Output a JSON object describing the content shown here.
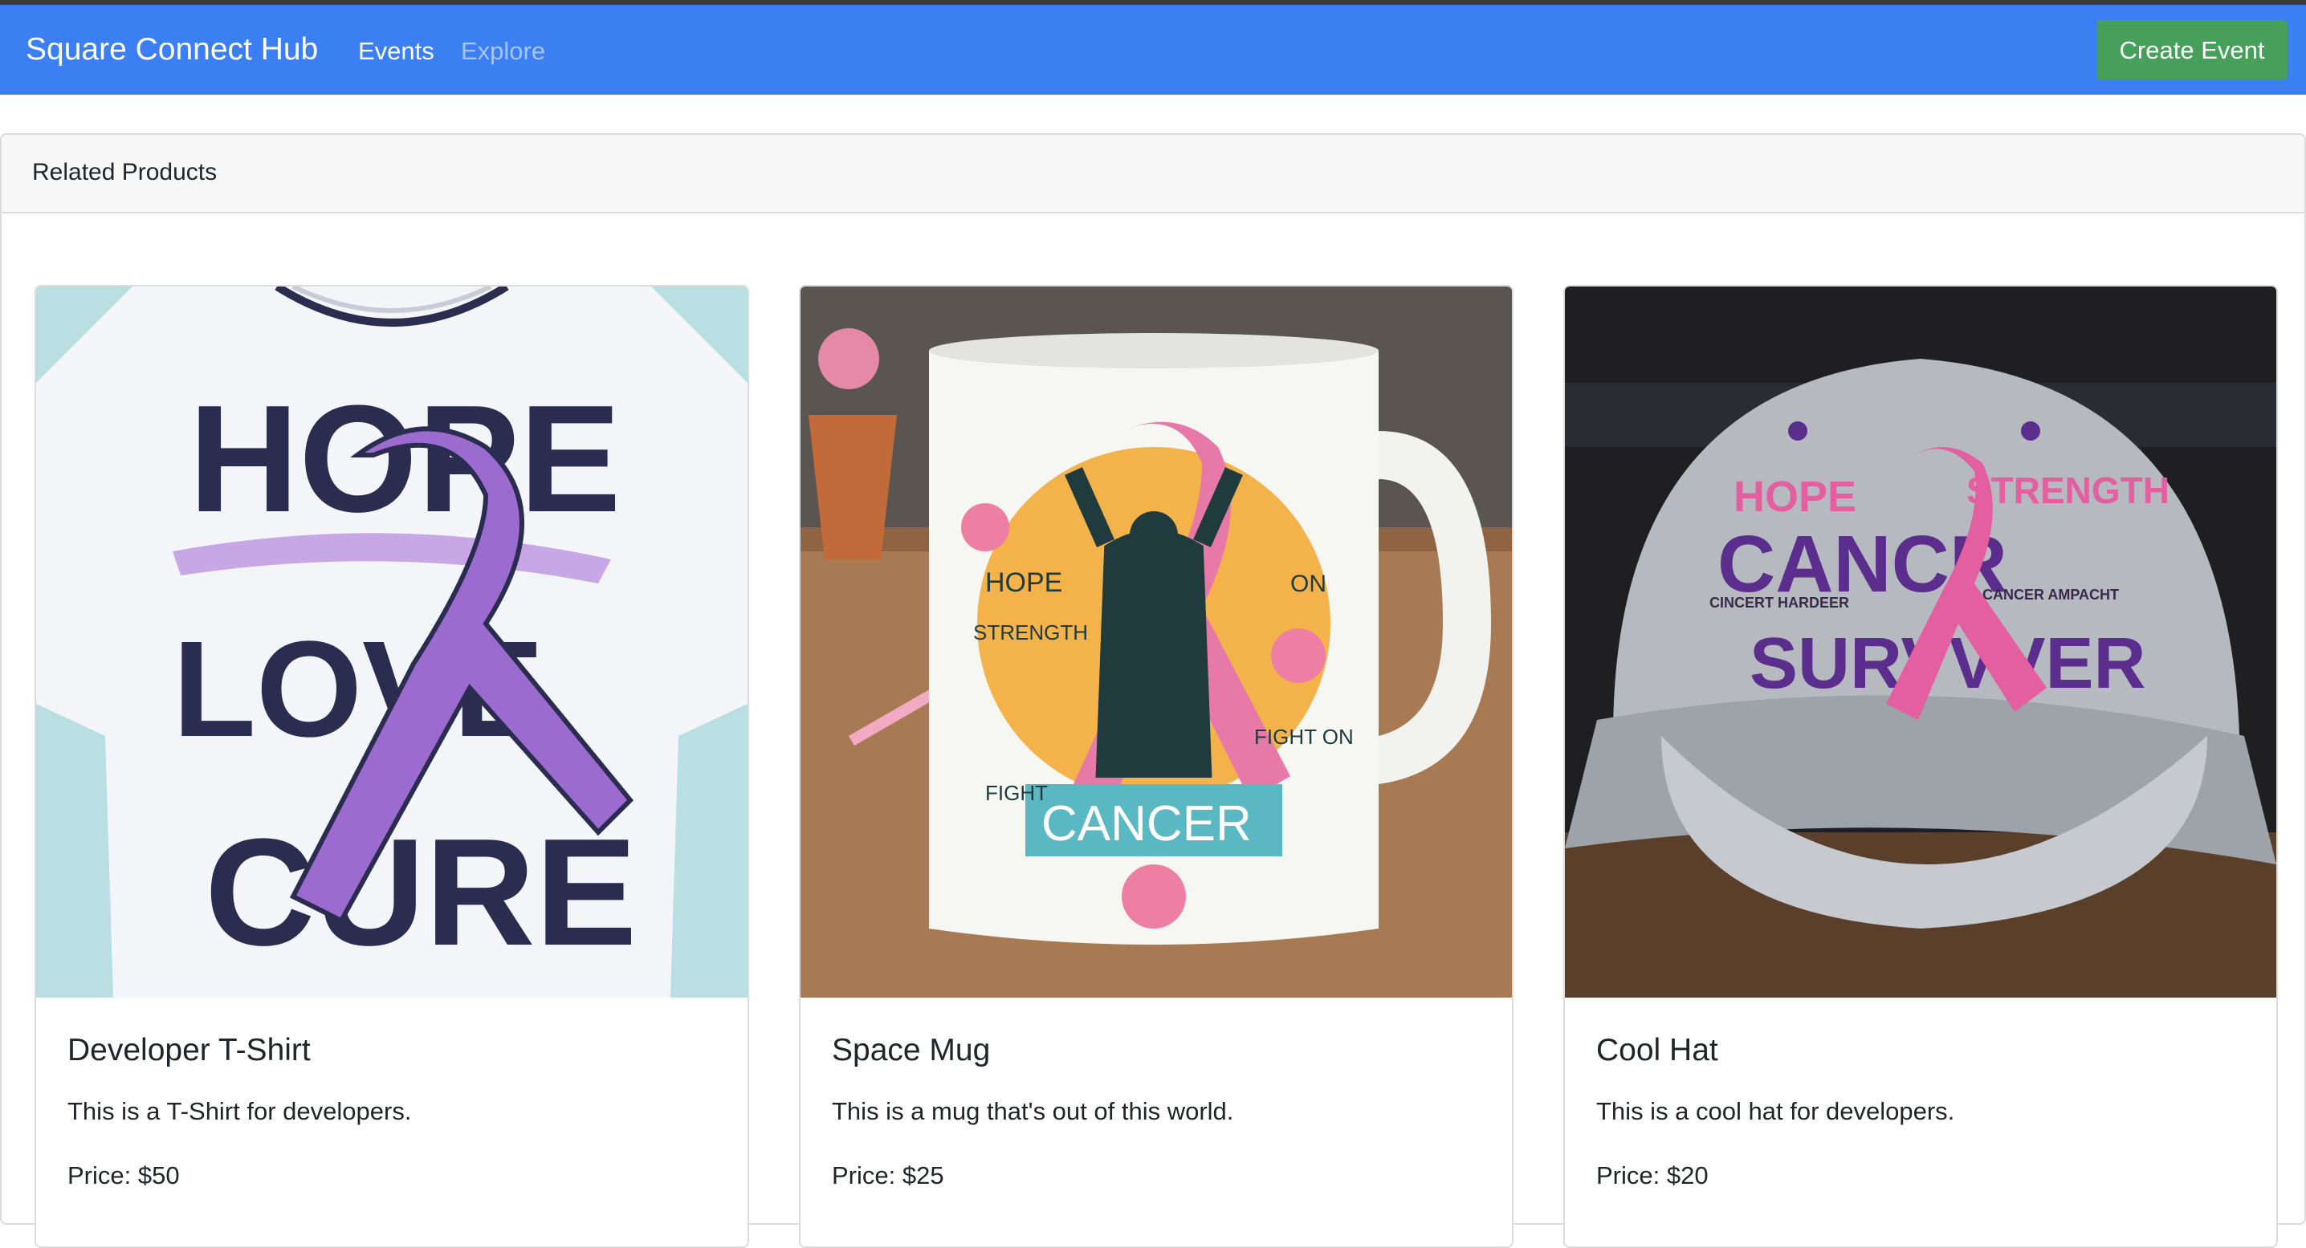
{
  "navbar": {
    "brand": "Square Connect Hub",
    "links": [
      "Events",
      "Explore"
    ],
    "create_button": "Create Event"
  },
  "colors": {
    "navbar_bg": "#3b7ff2",
    "create_button_bg": "#46a05a",
    "tshirt_ribbon": "#9b6bd0",
    "mug_ribbon": "#e779a8",
    "hat_body": "#9ea3a9"
  },
  "section": {
    "title": "Related Products"
  },
  "products": [
    {
      "name": "Developer T-Shirt",
      "description": "This is a T-Shirt for developers.",
      "price": "Price: $50",
      "image_text": [
        "HOPE",
        "LOVE",
        "CURE"
      ]
    },
    {
      "name": "Space Mug",
      "description": "This is a mug that's out of this world.",
      "price": "Price: $25",
      "image_text": [
        "HOPE",
        "STRENGTH",
        "ON",
        "FIGHT ON",
        "FIGHT",
        "CANCER"
      ]
    },
    {
      "name": "Cool Hat",
      "description": "This is a cool hat for developers.",
      "price": "Price: $20",
      "image_text": [
        "HOPE",
        "STRENGTH",
        "CANCR",
        "CINCERT HARDEER",
        "CANCER AMPACHT",
        "SURVVVER"
      ]
    }
  ]
}
